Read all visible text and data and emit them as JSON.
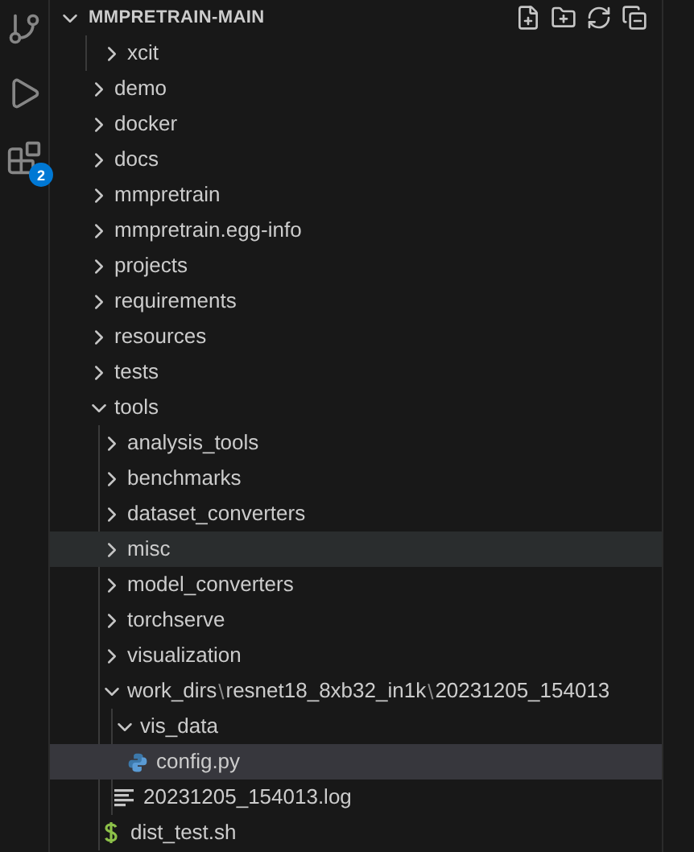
{
  "activity_bar": {
    "items": [
      {
        "kind": "source-control"
      },
      {
        "kind": "run-debug"
      },
      {
        "kind": "extensions",
        "badge": "2"
      }
    ]
  },
  "explorer": {
    "title": "MMPRETRAIN-MAIN",
    "expanded": true,
    "continued": [
      {
        "name": "xcit",
        "kind": "folder",
        "expanded": false,
        "selected": false,
        "hovered": false
      }
    ],
    "tree": [
      {
        "name": "demo",
        "kind": "folder",
        "expanded": false,
        "selected": false,
        "hovered": false
      },
      {
        "name": "docker",
        "kind": "folder",
        "expanded": false,
        "selected": false,
        "hovered": false
      },
      {
        "name": "docs",
        "kind": "folder",
        "expanded": false,
        "selected": false,
        "hovered": false
      },
      {
        "name": "mmpretrain",
        "kind": "folder",
        "expanded": false,
        "selected": false,
        "hovered": false
      },
      {
        "name": "mmpretrain.egg-info",
        "kind": "folder",
        "expanded": false,
        "selected": false,
        "hovered": false
      },
      {
        "name": "projects",
        "kind": "folder",
        "expanded": false,
        "selected": false,
        "hovered": false
      },
      {
        "name": "requirements",
        "kind": "folder",
        "expanded": false,
        "selected": false,
        "hovered": false
      },
      {
        "name": "resources",
        "kind": "folder",
        "expanded": false,
        "selected": false,
        "hovered": false
      },
      {
        "name": "tests",
        "kind": "folder",
        "expanded": false,
        "selected": false,
        "hovered": false
      },
      {
        "name": "tools",
        "kind": "folder",
        "expanded": true,
        "selected": false,
        "hovered": false,
        "children": [
          {
            "name": "analysis_tools",
            "kind": "folder",
            "expanded": false,
            "selected": false,
            "hovered": false
          },
          {
            "name": "benchmarks",
            "kind": "folder",
            "expanded": false,
            "selected": false,
            "hovered": false
          },
          {
            "name": "dataset_converters",
            "kind": "folder",
            "expanded": false,
            "selected": false,
            "hovered": false
          },
          {
            "name": "misc",
            "kind": "folder",
            "expanded": false,
            "selected": false,
            "hovered": true
          },
          {
            "name": "model_converters",
            "kind": "folder",
            "expanded": false,
            "selected": false,
            "hovered": false
          },
          {
            "name": "torchserve",
            "kind": "folder",
            "expanded": false,
            "selected": false,
            "hovered": false
          },
          {
            "name": "visualization",
            "kind": "folder",
            "expanded": false,
            "selected": false,
            "hovered": false
          },
          {
            "name": "work_dirs",
            "kind": "folder",
            "expanded": true,
            "selected": false,
            "hovered": false,
            "compact": [
              "resnet18_8xb32_in1k",
              "20231205_154013"
            ],
            "separator": "\\",
            "children": [
              {
                "name": "vis_data",
                "kind": "folder",
                "expanded": true,
                "selected": false,
                "hovered": false,
                "children": [
                  {
                    "name": "config.py",
                    "kind": "python",
                    "selected": true,
                    "hovered": false
                  }
                ]
              },
              {
                "name": "20231205_154013.log",
                "kind": "log",
                "selected": false,
                "hovered": false
              }
            ]
          },
          {
            "name": "dist_test.sh",
            "kind": "shell",
            "selected": false,
            "hovered": false
          }
        ]
      }
    ]
  }
}
